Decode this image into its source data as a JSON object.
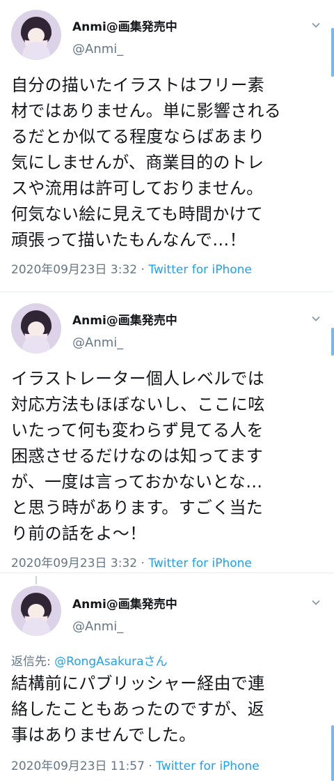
{
  "tweets": [
    {
      "display_name": "Anmi@画集発売中",
      "handle": "@Anmi_",
      "lines": [
        "自分の描いたイラストはフリー素",
        "材ではありません。単に影響される",
        "るだとか似てる程度ならばあまり",
        "気にしませんが、商業目的のトレ",
        "スや流用は許可しておりません。",
        "何気ない絵に見えても時間かけて",
        "頑張って描いたもんなんで…！"
      ],
      "timestamp": "2020年09月23日 3:32",
      "separator": " · ",
      "client": "Twitter for iPhone"
    },
    {
      "display_name": "Anmi@画集発売中",
      "handle": "@Anmi_",
      "lines": [
        "イラストレーター個人レベルでは",
        "対応方法もほぼないし、ここに呟",
        "いたって何も変わらず見てる人を",
        "困惑させるだけなのは知ってます",
        "が、一度は言っておかないとな…",
        "と思う時があります。すごく当た",
        "り前の話をよ〜！"
      ],
      "timestamp": "2020年09月23日 3:32",
      "separator": " · ",
      "client": "Twitter for iPhone"
    },
    {
      "display_name": "Anmi@画集発売中",
      "handle": "@Anmi_",
      "reply_prefix": "返信先: ",
      "reply_mention": "@RongAsakuraさん",
      "lines": [
        "結構前にパブリッシャー経由で連",
        "絡したこともあったのですが、返",
        "事はありませんでした。"
      ],
      "timestamp": "2020年09月23日 11:57",
      "separator": " · ",
      "client": "Twitter for iPhone"
    }
  ],
  "icons": {
    "caret": "chevron-down-icon",
    "avatar": "avatar"
  },
  "colors": {
    "link": "#1da1f2",
    "secondary_text": "#657786",
    "divider": "#e6ecf0",
    "scroll_accent": "#79b8ef"
  }
}
